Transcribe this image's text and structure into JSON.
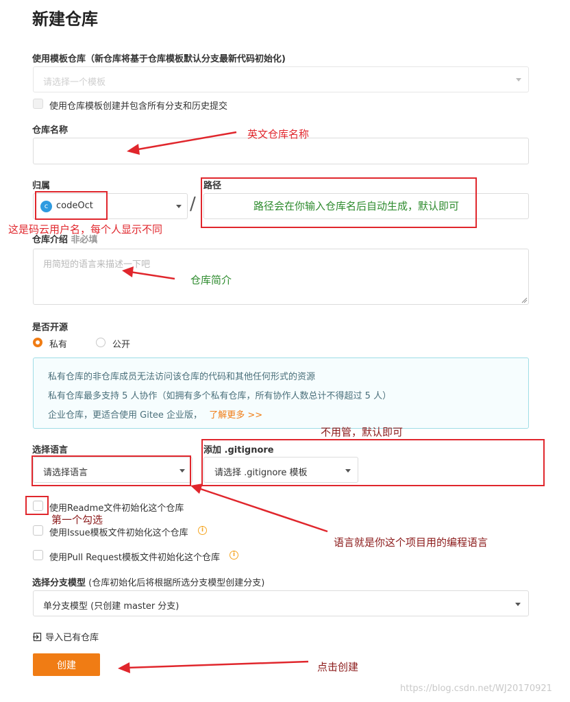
{
  "page": {
    "title": "新建仓库"
  },
  "template": {
    "label": "使用模板仓库（新仓库将基于仓库模板默认分支最新代码初始化)",
    "placeholder": "请选择一个模板",
    "include_all_label": "使用仓库模板创建并包含所有分支和历史提交"
  },
  "repo_name": {
    "label": "仓库名称",
    "value": ""
  },
  "owner": {
    "label": "归属",
    "username": "codeOct",
    "avatar_letter": "c"
  },
  "path": {
    "label": "路径",
    "separator": "/",
    "value": ""
  },
  "description": {
    "label": "仓库介绍",
    "optional": "非必填",
    "placeholder": "用简短的语言来描述一下吧"
  },
  "visibility": {
    "label": "是否开源",
    "options": [
      {
        "label": "私有",
        "selected": true
      },
      {
        "label": "公开",
        "selected": false
      }
    ],
    "notice": {
      "line1": "私有仓库的非仓库成员无法访问该仓库的代码和其他任何形式的资源",
      "line2": "私有仓库最多支持 5 人协作（如拥有多个私有仓库，所有协作人数总计不得超过 5 人）",
      "line3": "企业仓库，更适合使用 Gitee 企业版，",
      "link": "了解更多 >>"
    }
  },
  "language": {
    "label": "选择语言",
    "placeholder": "请选择语言"
  },
  "gitignore": {
    "label": "添加 .gitignore",
    "placeholder": "请选择 .gitignore 模板"
  },
  "init_options": [
    {
      "label": "使用Readme文件初始化这个仓库",
      "info": false
    },
    {
      "label": "使用Issue模板文件初始化这个仓库",
      "info": true
    },
    {
      "label": "使用Pull Request模板文件初始化这个仓库",
      "info": true
    }
  ],
  "branch_model": {
    "label": "选择分支模型",
    "hint": "(仓库初始化后将根据所选分支模型创建分支)",
    "selected": "单分支模型 (只创建 master 分支)"
  },
  "import_link": "导入已有仓库",
  "create_button": "创建",
  "annotations": {
    "repo_name": "英文仓库名称",
    "path": "路径会在你输入仓库名后自动生成，默认即可",
    "username": "这是码云用户名，每个人显示不同",
    "description": "仓库简介",
    "gitignore": "不用管，默认即可",
    "readme": "第一个勾选",
    "language": "语言就是你这个项目用的编程语言",
    "create": "点击创建"
  },
  "watermark": "https://blog.csdn.net/WJ20170921",
  "colors": {
    "accent": "#f07c14",
    "annotation_red": "#e0262c",
    "annotation_green": "#2e8b2e"
  }
}
